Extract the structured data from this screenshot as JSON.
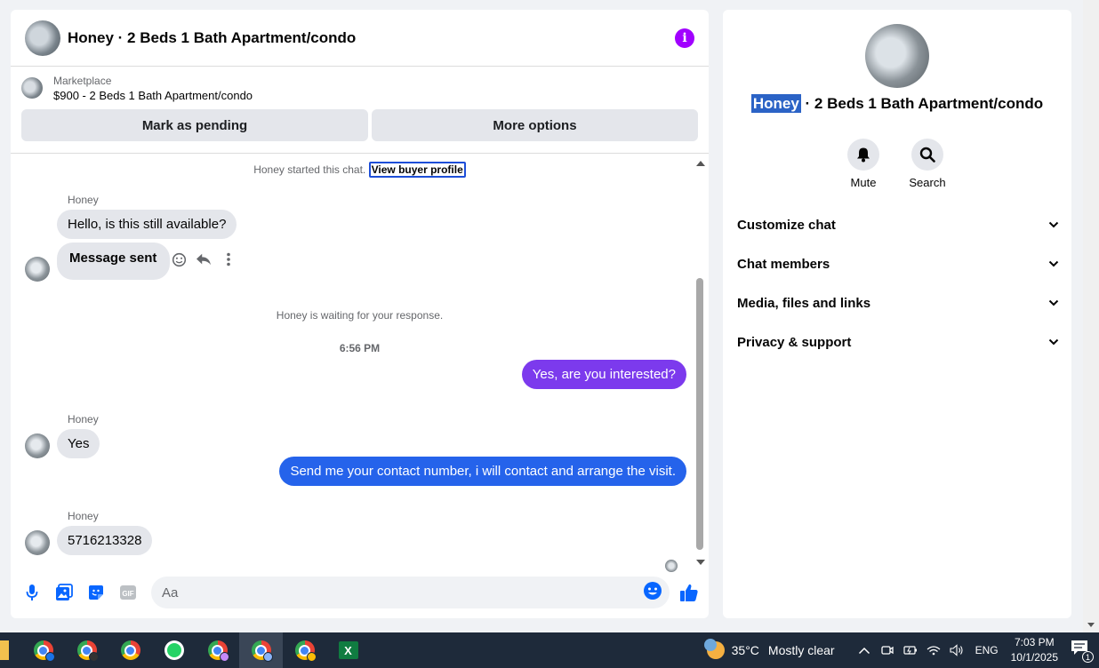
{
  "chat": {
    "title": "Honey · 2 Beds 1 Bath Apartment/condo",
    "marketplace_label": "Marketplace",
    "listing": "$900 - 2 Beds 1 Bath Apartment/condo",
    "mark_pending": "Mark as pending",
    "more_options": "More options",
    "started_text": "Honey started this chat.",
    "buyer_profile": "View buyer profile",
    "messages": [
      {
        "sender": "Honey",
        "text": "Hello, is this still available?"
      },
      {
        "text": "Message sent"
      },
      {
        "system": "Honey is waiting for your response."
      },
      {
        "time": "6:56 PM"
      },
      {
        "out": "Yes, are you interested?"
      },
      {
        "sender": "Honey",
        "text": "Yes"
      },
      {
        "out": "Send me your contact number, i will contact and arrange the visit."
      },
      {
        "sender": "Honey",
        "text": "5716213328"
      }
    ],
    "composer_placeholder": "Aa",
    "colors": {
      "out_bubble_1": "#7c3aed",
      "out_bubble_2": "#2563eb",
      "accent": "#0866ff"
    }
  },
  "details": {
    "name_highlight": "Honey",
    "name_rest": " · 2 Beds 1 Bath Apartment/condo",
    "mute": "Mute",
    "search": "Search",
    "sections": [
      "Customize chat",
      "Chat members",
      "Media, files and links",
      "Privacy & support"
    ]
  },
  "taskbar": {
    "temperature": "35°C",
    "weather": "Mostly clear",
    "lang": "ENG",
    "time": "7:03 PM",
    "date": "10/1/2025",
    "notifications": "1"
  }
}
